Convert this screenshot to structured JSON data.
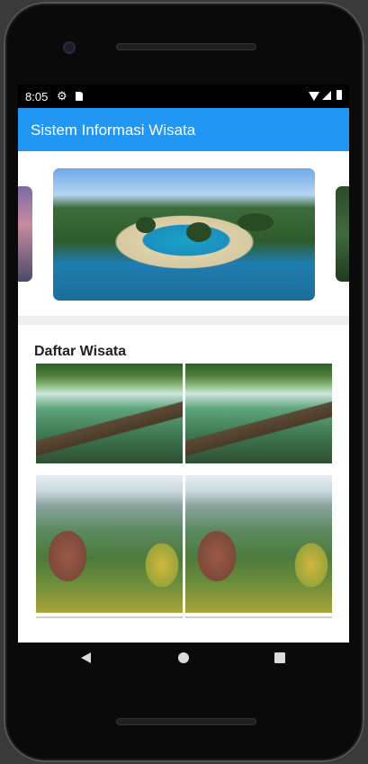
{
  "status_bar": {
    "time": "8:05",
    "icons": [
      "gear-icon",
      "sd-card-icon",
      "wifi-icon",
      "signal-icon",
      "battery-icon"
    ]
  },
  "app_bar": {
    "title": "Sistem Informasi Wisata",
    "color": "#2196F3"
  },
  "carousel": {
    "slides": [
      "sunset-landscape-image",
      "tropical-island-lagoon-image",
      "forest-image"
    ],
    "active_index": 1
  },
  "destinations": {
    "title": "Daftar Wisata",
    "items": [
      {
        "image": "river-waterfall-image"
      },
      {
        "image": "river-waterfall-image"
      },
      {
        "image": "canyon-valley-image"
      },
      {
        "image": "canyon-valley-image"
      }
    ]
  },
  "nav_bar": {
    "buttons": [
      "back-icon",
      "home-icon",
      "recents-icon"
    ]
  }
}
